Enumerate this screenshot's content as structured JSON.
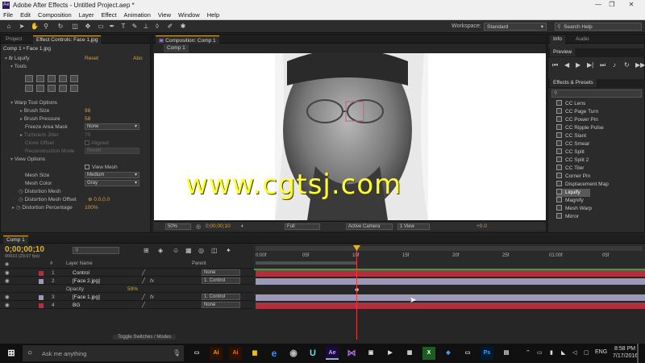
{
  "window": {
    "title": "Adobe After Effects - Untitled Project.aep *",
    "min": "—",
    "max": "❐",
    "close": "✕"
  },
  "menu": [
    "File",
    "Edit",
    "Composition",
    "Layer",
    "Effect",
    "Animation",
    "View",
    "Window",
    "Help"
  ],
  "toolbar": {
    "workspace_label": "Workspace:",
    "workspace_value": "Standard",
    "search_placeholder": "Search Help"
  },
  "left_panel": {
    "tabs": [
      "Project",
      "Effect Controls: Face 1.jpg"
    ],
    "breadcrumb": "Comp 1 • Face 1.jpg",
    "effect_name": "Liquify",
    "reset": "Reset",
    "about": "Abo",
    "tools_label": "Tools",
    "warp_tool_options": "Warp Tool Options",
    "brush_size_label": "Brush Size",
    "brush_size_value": "98",
    "brush_pressure_label": "Brush Pressure",
    "brush_pressure_value": "58",
    "freeze_area_mask_label": "Freeze Area Mask",
    "freeze_area_mask_value": "None",
    "turbulent_jitter_label": "Turbulent Jitter",
    "turbulent_jitter_value": "70",
    "clone_offset_label": "Clone Offset",
    "aligned_label": "Aligned",
    "reconstruction_mode_label": "Reconstruction Mode",
    "reconstruction_mode_value": "Revert",
    "view_options": "View Options",
    "view_mesh_label": "View Mesh",
    "mesh_size_label": "Mesh Size",
    "mesh_size_value": "Medium",
    "mesh_color_label": "Mesh Color",
    "mesh_color_value": "Gray",
    "distortion_mesh_label": "Distortion Mesh",
    "distortion_mesh_offset_label": "Distortion Mesh Offset",
    "distortion_mesh_offset_value": "0.0,0.0",
    "distortion_percentage_label": "Distortion Percentage",
    "distortion_percentage_value": "100%"
  },
  "composition": {
    "tab": "Composition: Comp 1",
    "subtab": "Comp 1",
    "watermark": "www.cgtsj.com",
    "zoom": "50%",
    "timecode": "0;00;00;10",
    "resolution": "Full",
    "camera": "Active Camera",
    "views": "1 View",
    "exposure": "+0.0"
  },
  "right_panel": {
    "tabs_top": [
      "Info",
      "Audio"
    ],
    "preview_tab": "Preview",
    "effects_tab": "Effects & Presets",
    "effects": [
      "CC Lens",
      "CC Page Turn",
      "CC Power Pin",
      "CC Ripple Pulse",
      "CC Slant",
      "CC Smear",
      "CC Split",
      "CC Split 2",
      "CC Tiler",
      "Corner Pin",
      "Displacement Map",
      "Liquify",
      "Magnify",
      "Mesh Warp",
      "Mirror"
    ],
    "selected_effect": "Liquify"
  },
  "timeline": {
    "tab": "Comp 1",
    "timecode": "0;00;00;10",
    "timecode_sub": "00010 (29.97 fps)",
    "col_layer_name": "Layer Name",
    "col_parent": "Parent",
    "ruler": [
      "0:00f",
      "05f",
      "10f",
      "15f",
      "20f",
      "25f",
      "01:00f",
      "05f"
    ],
    "layers": [
      {
        "num": "1",
        "name": "Control",
        "parent": "None"
      },
      {
        "num": "2",
        "name": "[Face 2.jpg]",
        "parent": "1. Control"
      },
      {
        "num": "3",
        "name": "[Face 1.jpg]",
        "parent": "1. Control"
      },
      {
        "num": "4",
        "name": "BG",
        "parent": "None"
      }
    ],
    "opacity_label": "Opacity",
    "opacity_value": "59%",
    "toggle_label": "Toggle Switches / Modes"
  },
  "taskbar": {
    "search_placeholder": "Ask me anything",
    "language": "ENG",
    "time": "8:58 PM",
    "date": "7/17/2016"
  },
  "colors": {
    "accent": "#e3b12c",
    "layer_red": "#b03040",
    "layer_lav": "#9a9ab8",
    "playhead": "#e04040"
  }
}
